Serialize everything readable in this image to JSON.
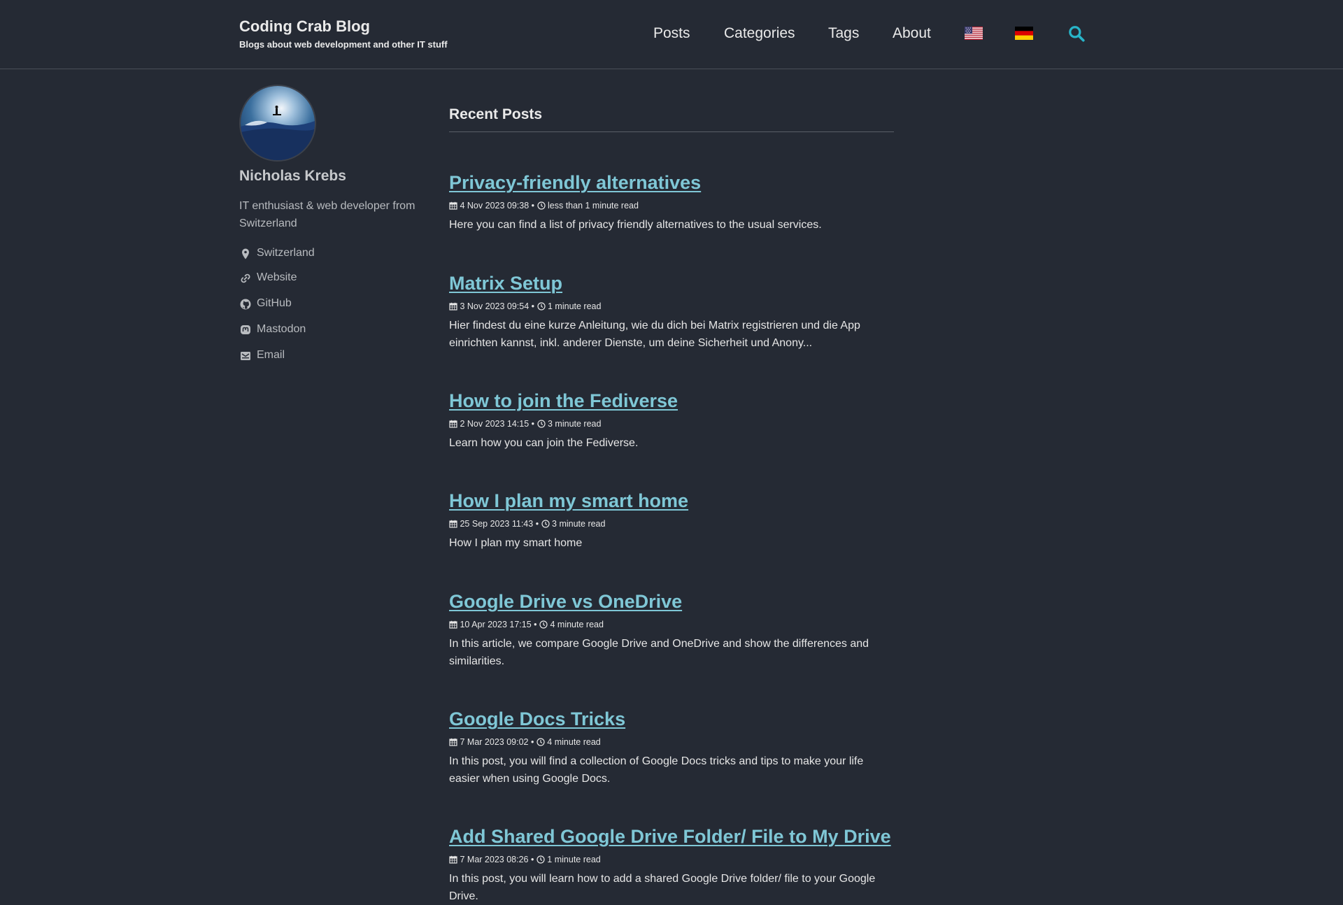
{
  "site": {
    "title": "Coding Crab Blog",
    "subtitle": "Blogs about web development and other IT stuff"
  },
  "nav": {
    "items": [
      {
        "label": "Posts"
      },
      {
        "label": "Categories"
      },
      {
        "label": "Tags"
      },
      {
        "label": "About"
      }
    ],
    "languages": [
      "flag-us-icon",
      "flag-de-icon"
    ],
    "search_icon": "search-icon"
  },
  "author": {
    "name": "Nicholas Krebs",
    "bio": "IT enthusiast & web developer from Switzerland",
    "links": [
      {
        "icon": "location-pin-icon",
        "label": "Switzerland"
      },
      {
        "icon": "link-icon",
        "label": "Website"
      },
      {
        "icon": "github-icon",
        "label": "GitHub"
      },
      {
        "icon": "mastodon-icon",
        "label": "Mastodon"
      },
      {
        "icon": "email-icon",
        "label": "Email"
      }
    ]
  },
  "main": {
    "heading": "Recent Posts",
    "posts": [
      {
        "title": "Privacy-friendly alternatives",
        "date": "4 Nov 2023 09:38",
        "read_time": "less than 1 minute read",
        "excerpt": "Here you can find a list of privacy friendly alternatives to the usual services."
      },
      {
        "title": "Matrix Setup",
        "date": "3 Nov 2023 09:54",
        "read_time": "1 minute read",
        "excerpt": "Hier findest du eine kurze Anleitung, wie du dich bei Matrix registrieren und die App einrichten kannst, inkl. anderer Dienste, um deine Sicherheit und Anony..."
      },
      {
        "title": "How to join the Fediverse",
        "date": "2 Nov 2023 14:15",
        "read_time": "3 minute read",
        "excerpt": "Learn how you can join the Fediverse."
      },
      {
        "title": "How I plan my smart home",
        "date": "25 Sep 2023 11:43",
        "read_time": "3 minute read",
        "excerpt": "How I plan my smart home"
      },
      {
        "title": "Google Drive vs OneDrive",
        "date": "10 Apr 2023 17:15",
        "read_time": "4 minute read",
        "excerpt": "In this article, we compare Google Drive and OneDrive and show the differences and similarities."
      },
      {
        "title": "Google Docs Tricks",
        "date": "7 Mar 2023 09:02",
        "read_time": "4 minute read",
        "excerpt": "In this post, you will find a collection of Google Docs tricks and tips to make your life easier when using Google Docs."
      },
      {
        "title": "Add Shared Google Drive Folder/ File to My Drive",
        "date": "7 Mar 2023 08:26",
        "read_time": "1 minute read",
        "excerpt": "In this post, you will learn how to add a shared Google Drive folder/ file to your Google Drive."
      }
    ]
  },
  "colors": {
    "background": "#252a34",
    "accent": "#7fc7d6",
    "search": "#28b4c8"
  }
}
